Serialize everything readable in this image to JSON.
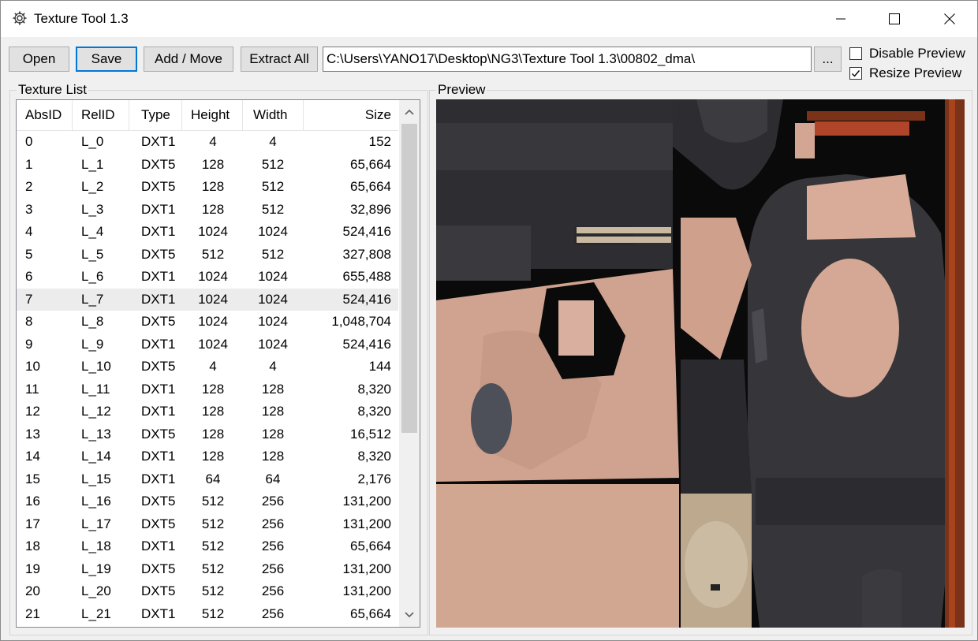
{
  "window": {
    "title": "Texture Tool 1.3",
    "icons": {
      "app": "gear-icon",
      "minimize": "minimize-icon",
      "maximize": "maximize-icon",
      "close": "close-icon"
    }
  },
  "toolbar": {
    "open_label": "Open",
    "save_label": "Save",
    "add_move_label": "Add / Move",
    "extract_all_label": "Extract All",
    "path_value": "C:\\Users\\YANO17\\Desktop\\NG3\\Texture Tool 1.3\\00802_dma\\",
    "browse_label": "...",
    "disable_preview_label": "Disable Preview",
    "disable_preview_checked": false,
    "resize_preview_label": "Resize Preview",
    "resize_preview_checked": true
  },
  "texture_list": {
    "group_label": "Texture List",
    "columns": [
      "AbsID",
      "RelID",
      "Type",
      "Height",
      "Width",
      "Size"
    ],
    "selected_index": 7,
    "rows": [
      [
        "0",
        "L_0",
        "DXT1",
        "4",
        "4",
        "152"
      ],
      [
        "1",
        "L_1",
        "DXT5",
        "128",
        "512",
        "65,664"
      ],
      [
        "2",
        "L_2",
        "DXT5",
        "128",
        "512",
        "65,664"
      ],
      [
        "3",
        "L_3",
        "DXT1",
        "128",
        "512",
        "32,896"
      ],
      [
        "4",
        "L_4",
        "DXT1",
        "1024",
        "1024",
        "524,416"
      ],
      [
        "5",
        "L_5",
        "DXT5",
        "512",
        "512",
        "327,808"
      ],
      [
        "6",
        "L_6",
        "DXT1",
        "1024",
        "1024",
        "655,488"
      ],
      [
        "7",
        "L_7",
        "DXT1",
        "1024",
        "1024",
        "524,416"
      ],
      [
        "8",
        "L_8",
        "DXT5",
        "1024",
        "1024",
        "1,048,704"
      ],
      [
        "9",
        "L_9",
        "DXT1",
        "1024",
        "1024",
        "524,416"
      ],
      [
        "10",
        "L_10",
        "DXT5",
        "4",
        "4",
        "144"
      ],
      [
        "11",
        "L_11",
        "DXT1",
        "128",
        "128",
        "8,320"
      ],
      [
        "12",
        "L_12",
        "DXT1",
        "128",
        "128",
        "8,320"
      ],
      [
        "13",
        "L_13",
        "DXT5",
        "128",
        "128",
        "16,512"
      ],
      [
        "14",
        "L_14",
        "DXT1",
        "128",
        "128",
        "8,320"
      ],
      [
        "15",
        "L_15",
        "DXT1",
        "64",
        "64",
        "2,176"
      ],
      [
        "16",
        "L_16",
        "DXT5",
        "512",
        "256",
        "131,200"
      ],
      [
        "17",
        "L_17",
        "DXT5",
        "512",
        "256",
        "131,200"
      ],
      [
        "18",
        "L_18",
        "DXT1",
        "512",
        "256",
        "65,664"
      ],
      [
        "19",
        "L_19",
        "DXT5",
        "512",
        "256",
        "131,200"
      ],
      [
        "20",
        "L_20",
        "DXT5",
        "512",
        "256",
        "131,200"
      ],
      [
        "21",
        "L_21",
        "DXT1",
        "512",
        "256",
        "65,664"
      ]
    ]
  },
  "preview": {
    "group_label": "Preview",
    "colors": {
      "skin": "#d7ab96",
      "skin_dark": "#c49a86",
      "leather": "#3a3a3e",
      "leather_dark": "#242428",
      "black": "#0a0a0a",
      "wood": "#a8431e",
      "bone": "#c9b9a0"
    }
  }
}
